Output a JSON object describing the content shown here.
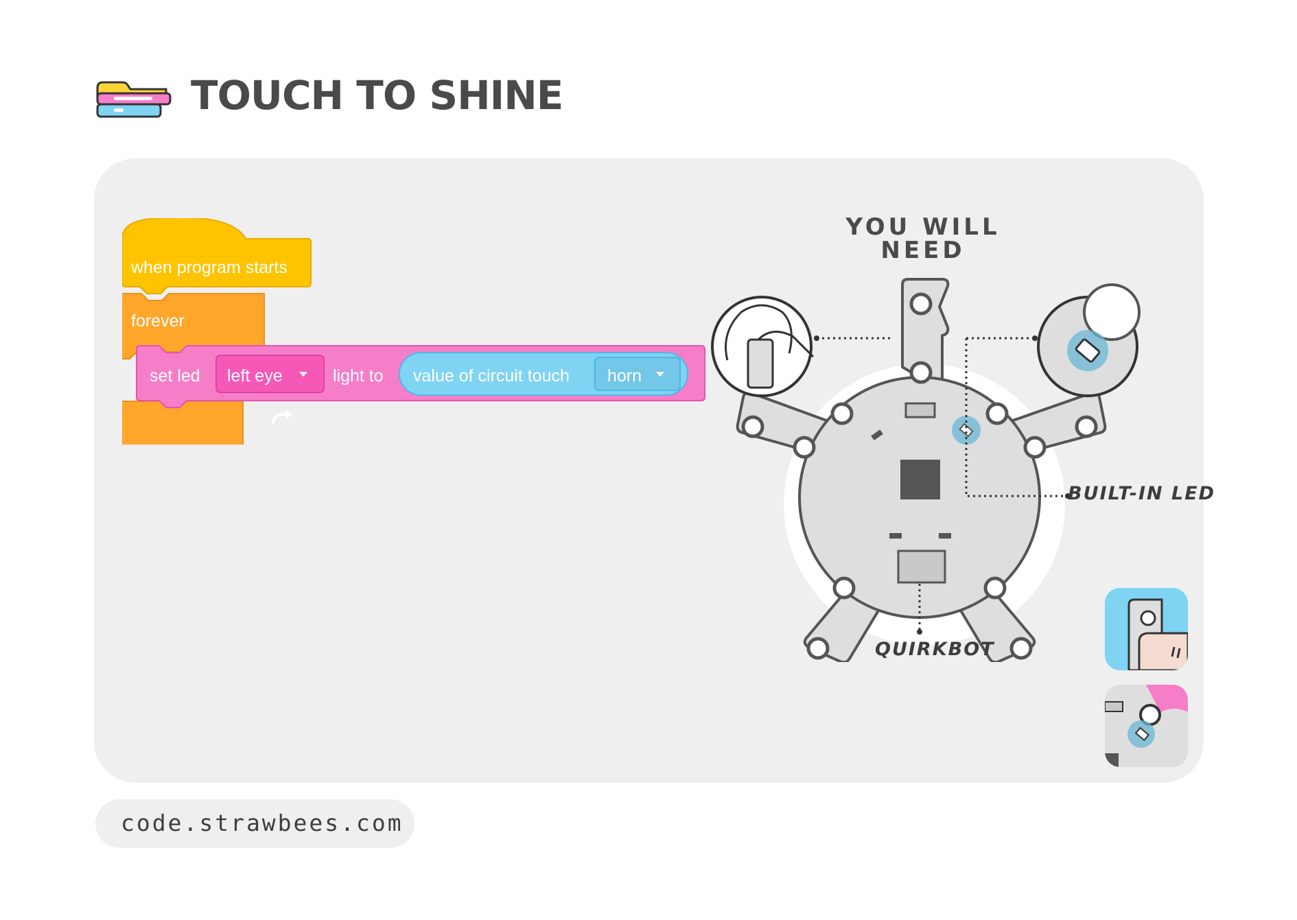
{
  "page": {
    "title": "TOUCH TO SHINE",
    "logo_icon": "strawbees-code-blocks-logo"
  },
  "program": {
    "hat_block": "when program starts",
    "loop_block": "forever",
    "set_led": {
      "label": "set led",
      "led_option": "left eye",
      "light_to_label": "light to",
      "reporter_label": "value of circuit touch",
      "touch_option": "horn"
    }
  },
  "requirements": {
    "heading": "YOU WILL NEED",
    "callout_led": "BUILT-IN LED",
    "callout_bot": "QUIRKBOT"
  },
  "footer": {
    "url": "code.strawbees.com"
  },
  "colors": {
    "hat": "#ffc300",
    "loop": "#ffa62b",
    "pink_block": "#f67ec9",
    "pink_dropdown": "#f658b8",
    "blue_reporter": "#7fd3f3",
    "card": "#efefef",
    "board": "#dedede",
    "led_highlight": "#6ab7d6"
  }
}
